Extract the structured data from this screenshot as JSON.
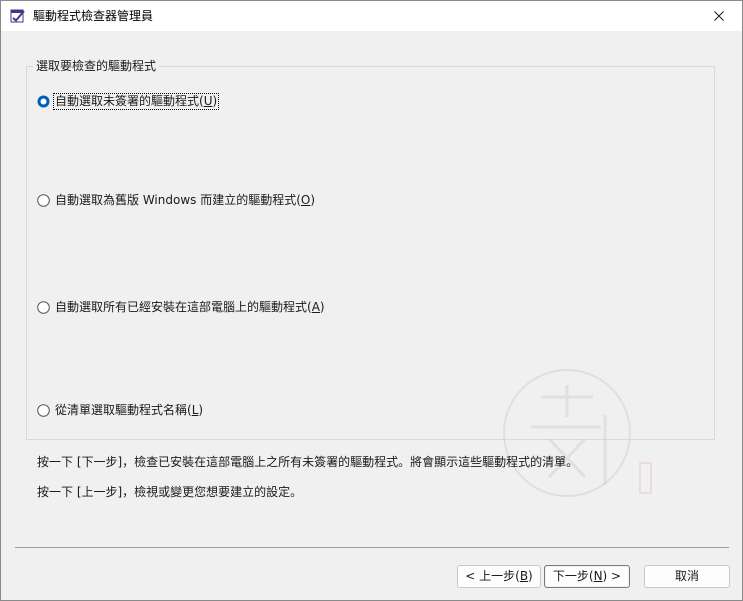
{
  "window": {
    "title": "驅動程式檢查器管理員",
    "icon": "verifier-app-icon"
  },
  "group": {
    "legend": "選取要檢查的驅動程式"
  },
  "options": [
    {
      "pre": "自動選取未簽署的驅動程式(",
      "key": "U",
      "post": ")",
      "selected": true
    },
    {
      "pre": "自動選取為舊版 Windows 而建立的驅動程式(",
      "key": "O",
      "post": ")",
      "selected": false
    },
    {
      "pre": "自動選取所有已經安裝在這部電腦上的驅動程式(",
      "key": "A",
      "post": ")",
      "selected": false
    },
    {
      "pre": "從清單選取驅動程式名稱(",
      "key": "L",
      "post": ")",
      "selected": false
    }
  ],
  "info": {
    "next_hint": "按一下 [下一步]，檢查已安裝在這部電腦上之所有未簽署的驅動程式。將會顯示這些驅動程式的清單。",
    "back_hint": "按一下 [上一步]，檢視或變更您想要建立的設定。"
  },
  "buttons": {
    "back": {
      "pre": "< 上一步(",
      "key": "B",
      "post": ")"
    },
    "next": {
      "pre": "下一步(",
      "key": "N",
      "post": ") >"
    },
    "cancel": "取消"
  },
  "colors": {
    "accent": "#005fb8",
    "dialog_bg": "#f0f0f0",
    "titlebar_bg": "#ffffff"
  }
}
